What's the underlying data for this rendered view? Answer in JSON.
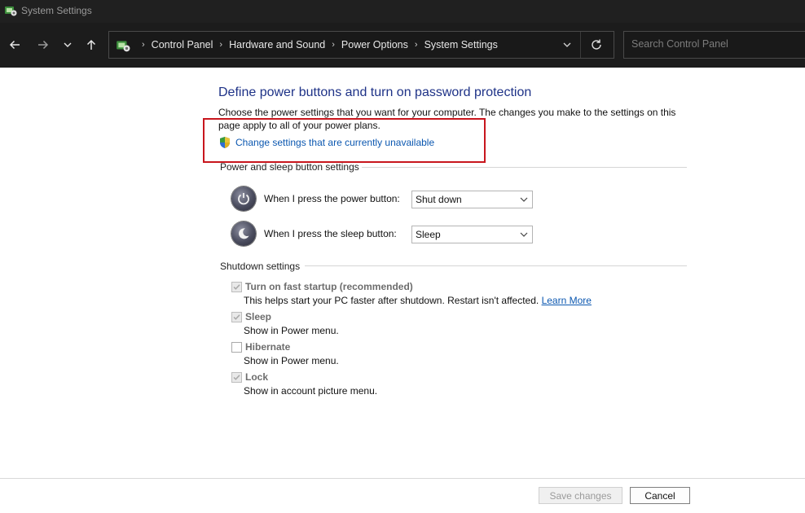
{
  "window": {
    "title": "System Settings"
  },
  "nav": {
    "breadcrumbs": [
      "Control Panel",
      "Hardware and Sound",
      "Power Options",
      "System Settings"
    ],
    "search_placeholder": "Search Control Panel"
  },
  "page": {
    "heading": "Define power buttons and turn on password protection",
    "description": "Choose the power settings that you want for your computer. The changes you make to the settings on this page apply to all of your power plans.",
    "change_link": "Change settings that are currently unavailable"
  },
  "power_section": {
    "title": "Power and sleep button settings",
    "power_button": {
      "label": "When I press the power button:",
      "value": "Shut down"
    },
    "sleep_button": {
      "label": "When I press the sleep button:",
      "value": "Sleep"
    }
  },
  "shutdown_section": {
    "title": "Shutdown settings",
    "options": [
      {
        "label": "Turn on fast startup (recommended)",
        "desc": "This helps start your PC faster after shutdown. Restart isn't affected.",
        "link": "Learn More",
        "checked": true
      },
      {
        "label": "Sleep",
        "desc": "Show in Power menu.",
        "checked": true
      },
      {
        "label": "Hibernate",
        "desc": "Show in Power menu.",
        "checked": false
      },
      {
        "label": "Lock",
        "desc": "Show in account picture menu.",
        "checked": true
      }
    ]
  },
  "footer": {
    "save_label": "Save changes",
    "cancel_label": "Cancel"
  },
  "colors": {
    "heading": "#1e3287",
    "link": "#0b57b0",
    "highlight": "#c8161d",
    "titlebar": "#202020"
  },
  "icons": [
    "control-panel-icon",
    "back-arrow-icon",
    "forward-arrow-icon",
    "chevron-down-icon",
    "up-arrow-icon",
    "refresh-icon",
    "uac-shield-icon",
    "power-icon",
    "sleep-moon-icon",
    "checkmark-icon"
  ]
}
